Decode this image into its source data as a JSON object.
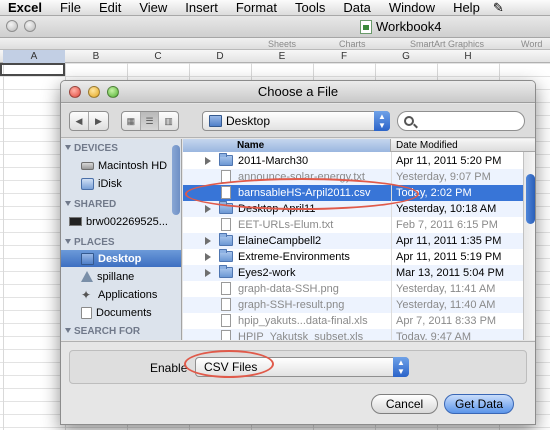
{
  "menubar": {
    "items": [
      "Excel",
      "File",
      "Edit",
      "View",
      "Insert",
      "Format",
      "Tools",
      "Data",
      "Window",
      "Help"
    ],
    "script_icon": "script-menu-icon"
  },
  "workbook": {
    "title": "Workbook4",
    "ribbon_groups": [
      "Sheets",
      "Charts",
      "SmartArt Graphics",
      "Word"
    ],
    "columns": [
      "A",
      "B",
      "C",
      "D",
      "E",
      "F",
      "G",
      "H"
    ]
  },
  "dialog": {
    "title": "Choose a File",
    "location": "Desktop",
    "search_value": "",
    "sidebar": {
      "devices_header": "DEVICES",
      "devices": [
        "Macintosh HD",
        "iDisk"
      ],
      "shared_header": "SHARED",
      "shared": [
        "brw002269525..."
      ],
      "places_header": "PLACES",
      "places": [
        "Desktop",
        "spillane",
        "Applications",
        "Documents"
      ],
      "search_header": "SEARCH FOR"
    },
    "columns": {
      "name": "Name",
      "date": "Date Modified"
    },
    "files": [
      {
        "name": "2011-March30",
        "date": "Apr 11, 2011 5:20 PM",
        "kind": "folder",
        "dim": false
      },
      {
        "name": "announce-solar-energy.txt",
        "date": "Yesterday, 9:07 PM",
        "kind": "doc",
        "dim": true
      },
      {
        "name": "barnsableHS-Arpil2011.csv",
        "date": "Today, 2:02 PM",
        "kind": "doc",
        "dim": false,
        "selected": true
      },
      {
        "name": "Desktop-April11",
        "date": "Yesterday, 10:18 AM",
        "kind": "folder",
        "dim": false
      },
      {
        "name": "EET-URLs-Elum.txt",
        "date": "Feb 7, 2011 6:15 PM",
        "kind": "doc",
        "dim": true
      },
      {
        "name": "ElaineCampbell2",
        "date": "Apr 11, 2011 1:35 PM",
        "kind": "folder",
        "dim": false
      },
      {
        "name": "Extreme-Environments",
        "date": "Apr 11, 2011 5:19 PM",
        "kind": "folder",
        "dim": false
      },
      {
        "name": "Eyes2-work",
        "date": "Mar 13, 2011 5:04 PM",
        "kind": "folder",
        "dim": false
      },
      {
        "name": "graph-data-SSH.png",
        "date": "Yesterday, 11:41 AM",
        "kind": "doc",
        "dim": true
      },
      {
        "name": "graph-SSH-result.png",
        "date": "Yesterday, 11:40 AM",
        "kind": "doc",
        "dim": true
      },
      {
        "name": "hpip_yakuts...data-final.xls",
        "date": "Apr 7, 2011 8:33 PM",
        "kind": "doc",
        "dim": true
      },
      {
        "name": "HPIP_Yakutsk_subset.xls",
        "date": "Today, 9:47 AM",
        "kind": "doc",
        "dim": true
      }
    ],
    "enable_label": "Enable",
    "enable_value": "CSV Files",
    "cancel_label": "Cancel",
    "get_data_label": "Get Data"
  }
}
